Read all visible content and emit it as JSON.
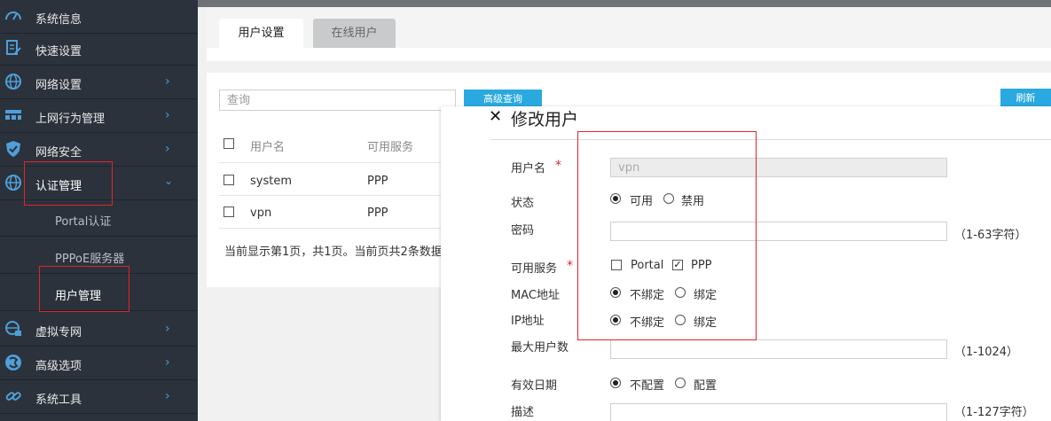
{
  "sidebar": {
    "items": [
      {
        "label": "系统信息",
        "icon": "speedometer-icon"
      },
      {
        "label": "快速设置",
        "icon": "clipboard-edit-icon"
      },
      {
        "label": "网络设置",
        "icon": "globe-icon"
      },
      {
        "label": "上网行为管理",
        "icon": "grid-icon"
      },
      {
        "label": "网络安全",
        "icon": "shield-icon"
      },
      {
        "label": "认证管理",
        "icon": "globe-icon"
      },
      {
        "label": "虚拟专网",
        "icon": "globe-lock-icon"
      },
      {
        "label": "高级选项",
        "icon": "settings-sphere-icon"
      },
      {
        "label": "系统工具",
        "icon": "link-icon"
      }
    ],
    "subitems": [
      {
        "label": "Portal认证"
      },
      {
        "label": "PPPoE服务器"
      },
      {
        "label": "用户管理"
      }
    ],
    "accent": "#4f9fd8"
  },
  "tabs": [
    {
      "label": "用户设置",
      "active": true
    },
    {
      "label": "在线用户",
      "active": false
    }
  ],
  "toolbar": {
    "search_placeholder": "查询",
    "advanced_label": "高级查询",
    "refresh_label": "刷新"
  },
  "table": {
    "headers": [
      "用户名",
      "可用服务"
    ],
    "rows": [
      [
        "system",
        "PPP"
      ],
      [
        "vpn",
        "PPP"
      ]
    ],
    "footer": "当前显示第1页，共1页。当前页共2条数据"
  },
  "modal": {
    "close_glyph": "✕",
    "title": "修改用户",
    "required_mark": "*",
    "fields": {
      "username": {
        "label": "用户名",
        "value": "vpn"
      },
      "status": {
        "label": "状态",
        "options": [
          "可用",
          "禁用"
        ],
        "selected": "可用"
      },
      "password": {
        "label": "密码",
        "hint": "（1-63字符）"
      },
      "services": {
        "label": "可用服务",
        "options": [
          "Portal",
          "PPP"
        ],
        "checked": [
          "PPP"
        ]
      },
      "mac": {
        "label": "MAC地址",
        "options": [
          "不绑定",
          "绑定"
        ],
        "selected": "不绑定"
      },
      "ip": {
        "label": "IP地址",
        "options": [
          "不绑定",
          "绑定"
        ],
        "selected": "不绑定"
      },
      "max_users": {
        "label": "最大用户数",
        "hint": "（1-1024）"
      },
      "expiry": {
        "label": "有效日期",
        "options": [
          "不配置",
          "配置"
        ],
        "selected": "不配置"
      },
      "desc": {
        "label": "描述",
        "hint": "（1-127字符）"
      }
    }
  },
  "colors": {
    "sidebar_bg": "#2b323b",
    "button_blue": "#29a9e0",
    "highlight_red": "#e0252b"
  }
}
